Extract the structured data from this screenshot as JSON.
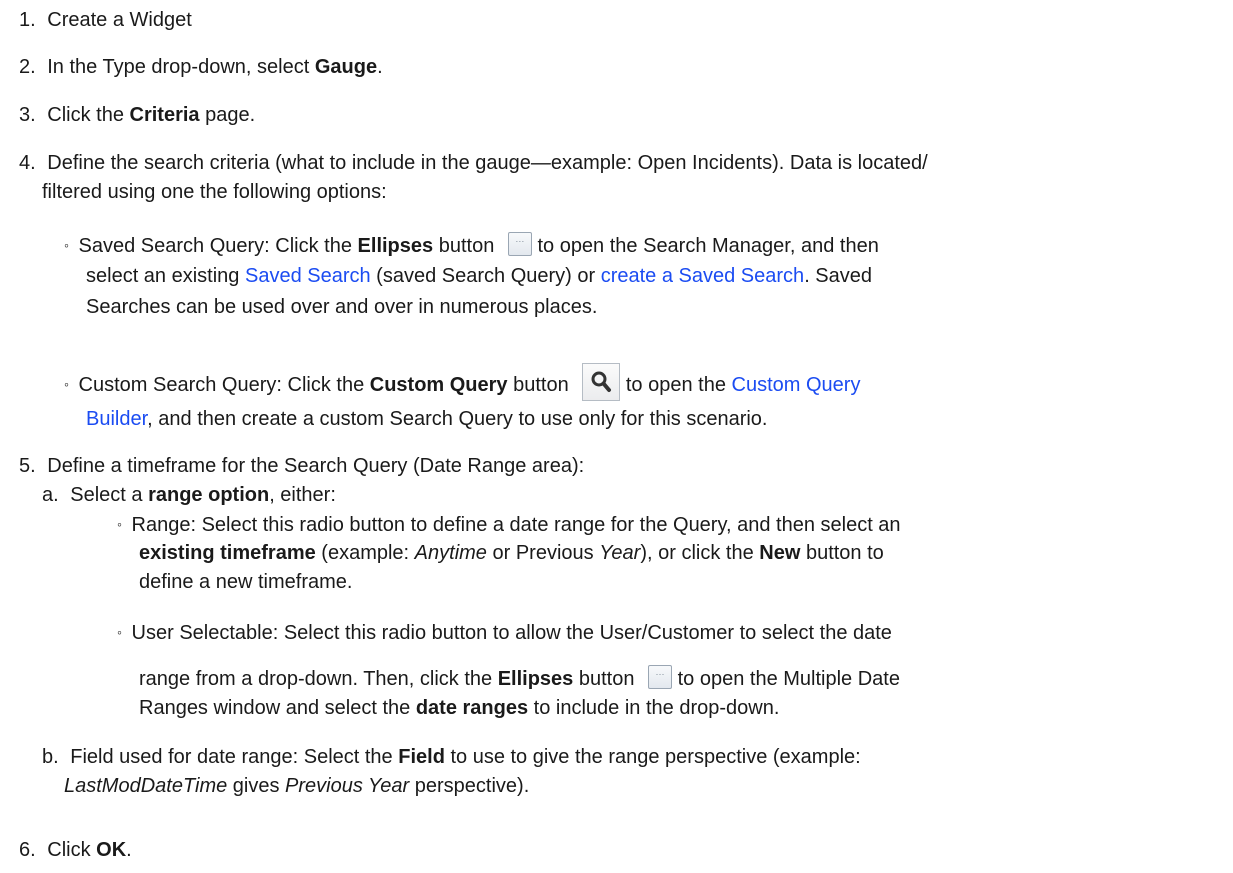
{
  "steps": {
    "s1": {
      "num": "1.",
      "text": "Create a Widget"
    },
    "s2": {
      "num": "2.",
      "pre": "In the Type drop-down, select ",
      "bold": "Gauge",
      "post": "."
    },
    "s3": {
      "num": "3.",
      "pre": "Click the ",
      "bold": "Criteria",
      "post": " page."
    },
    "s4": {
      "num": "4.",
      "line1": "Define the search criteria (what to include in the gauge—example: Open Incidents). Data is located/",
      "line2": "filtered using one the following options:"
    },
    "saved": {
      "bullet": "◦",
      "pre": "Saved Search Query: Click the ",
      "bold": "Ellipses",
      "post": " button",
      "post2": " to open the Search Manager, and then",
      "l2_pre": "select an existing ",
      "link1": "Saved Search",
      "l2_mid": " (saved Search Query) or ",
      "link2": "create a Saved Search",
      "l2_post": ". Saved",
      "l3": "Searches can be used over and over in numerous places."
    },
    "custom": {
      "bullet": "◦",
      "pre": "Custom Search Query: Click the ",
      "bold": "Custom Query",
      "post": " button",
      "post2": " to open the ",
      "link1": "Custom Query",
      "link1b": "Builder",
      "l2_post": ", and then create a custom Search Query to use only for this scenario."
    },
    "s5": {
      "num": "5.",
      "text": "Define a timeframe for the Search Query (Date Range area):"
    },
    "s5a": {
      "num": "a.",
      "pre": "Select a ",
      "bold": "range option",
      "post": ", either:"
    },
    "range": {
      "bullet": "◦",
      "l1": "Range: Select this radio button to define a date range for the Query, and then select an",
      "l2_bold": "existing timeframe",
      "l2_mid": " (example: ",
      "l2_it1": "Anytime",
      "l2_mid2": " or Previous ",
      "l2_it2": "Year",
      "l2_mid3": "), or click the ",
      "l2_bold2": "New",
      "l2_post": " button to",
      "l3": "define a new timeframe."
    },
    "usersel": {
      "bullet": "◦",
      "l1": "User Selectable: Select this radio button to allow the User/Customer to select the date",
      "l2_pre": "range from a drop-down. Then, click the ",
      "l2_bold": "Ellipses",
      "l2_mid": " button",
      "l2_post": " to open the Multiple Date",
      "l3_pre": "Ranges window and select the ",
      "l3_bold": "date ranges",
      "l3_post": " to include in the drop-down."
    },
    "s5b": {
      "num": "b.",
      "l1_pre": "Field used for date range: Select the ",
      "l1_bold": "Field",
      "l1_post": " to use to give the range perspective (example:",
      "l2_it1": "LastModDateTime",
      "l2_mid": " gives ",
      "l2_it2": "Previous Year",
      "l2_post": " perspective)."
    },
    "s6": {
      "num": "6.",
      "pre": "Click ",
      "bold": "OK",
      "post": "."
    }
  },
  "icons": {
    "ellipses": "ellipses-button-icon",
    "search": "magnifier-search-icon"
  }
}
